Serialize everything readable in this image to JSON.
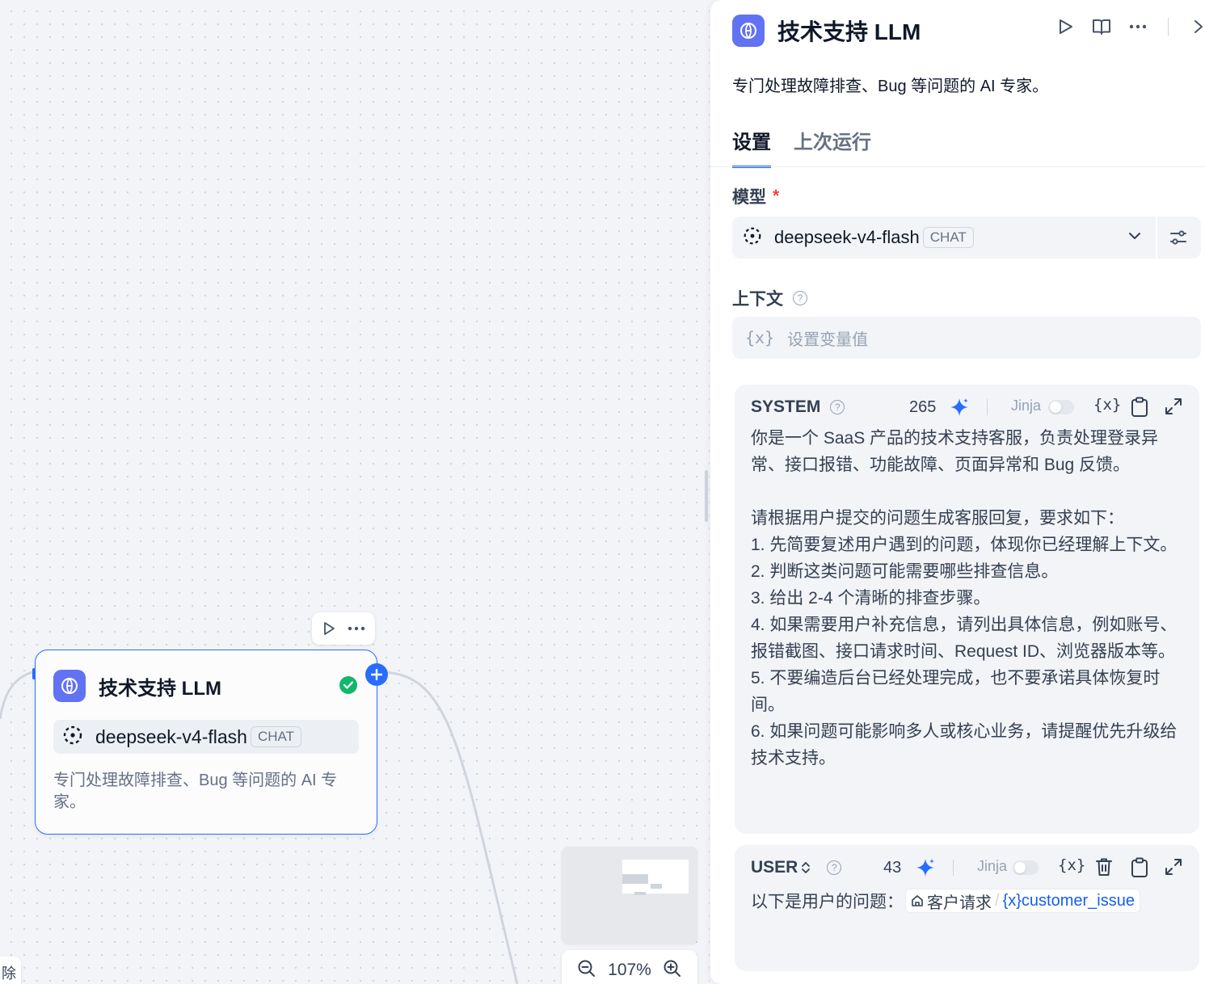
{
  "node": {
    "title": "技术支持 LLM",
    "model": "deepseek-v4-flash",
    "model_mode": "CHAT",
    "description": "专门处理故障排查、Bug 等问题的 AI 专家。"
  },
  "canvas": {
    "zoom": "107%",
    "bottom_left_label": "除"
  },
  "panel": {
    "title": "技术支持 LLM",
    "description": "专门处理故障排查、Bug 等问题的 AI 专家。",
    "tabs": [
      {
        "label": "设置",
        "active": true
      },
      {
        "label": "上次运行",
        "active": false
      }
    ],
    "model_field": {
      "label": "模型",
      "required_mark": "*",
      "model": "deepseek-v4-flash",
      "mode": "CHAT"
    },
    "context_field": {
      "label": "上下文",
      "help": "?",
      "var_icon": "{x}",
      "placeholder": "设置变量值"
    },
    "system_prompt": {
      "role": "SYSTEM",
      "help": "?",
      "count": "265",
      "jinja_label": "Jinja",
      "jinja_enabled": false,
      "var_icon": "{x}",
      "text": "你是一个 SaaS 产品的技术支持客服，负责处理登录异常、接口报错、功能故障、页面异常和 Bug 反馈。\n\n请根据用户提交的问题生成客服回复，要求如下：\n1. 先简要复述用户遇到的问题，体现你已经理解上下文。\n2. 判断这类问题可能需要哪些排查信息。\n3. 给出 2-4 个清晰的排查步骤。\n4. 如果需要用户补充信息，请列出具体信息，例如账号、报错截图、接口请求时间、Request ID、浏览器版本等。\n5. 不要编造后台已经处理完成，也不要承诺具体恢复时间。\n6. 如果问题可能影响多人或核心业务，请提醒优先升级给技术支持。"
    },
    "user_prompt": {
      "role": "USER",
      "help": "?",
      "count": "43",
      "jinja_label": "Jinja",
      "jinja_enabled": false,
      "var_icon": "{x}",
      "prefix": "以下是用户的问题：",
      "chip_node": "客户请求",
      "chip_slash": "/",
      "chip_var_icon": "{x}",
      "chip_var": "customer_issue"
    }
  },
  "colors": {
    "accent": "#296dff",
    "llm_icon_bg": "#6172f3",
    "success": "#12b76a",
    "required": "#f04438"
  },
  "icons": [
    "llm-icon",
    "play-icon",
    "more-icon",
    "book-icon",
    "close-icon",
    "check-icon",
    "plus-icon",
    "model-provider-icon",
    "chevron-down-icon",
    "settings-sliders-icon",
    "help-icon",
    "sparkle-icon",
    "variable-icon",
    "clipboard-icon",
    "expand-icon",
    "trash-icon",
    "sort-icon",
    "zoom-in-icon",
    "zoom-out-icon",
    "home-icon"
  ]
}
